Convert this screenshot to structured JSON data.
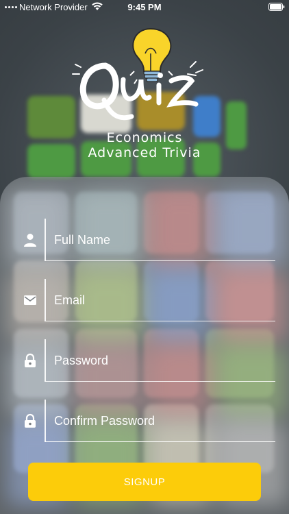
{
  "status_bar": {
    "carrier": "Network Provider",
    "time": "9:45 PM",
    "wifi_icon": "wifi-icon",
    "battery_icon": "battery-icon"
  },
  "logo": {
    "wordmark": "Quiz",
    "icon": "lightbulb-icon",
    "accent_color": "#f9d42a"
  },
  "subtitle": {
    "line1": "Economics",
    "line2": "Advanced Trivia"
  },
  "form": {
    "fields": [
      {
        "placeholder": "Full Name",
        "value": "",
        "icon": "person-icon",
        "type": "text"
      },
      {
        "placeholder": "Email",
        "value": "",
        "icon": "mail-icon",
        "type": "email"
      },
      {
        "placeholder": "Password",
        "value": "",
        "icon": "lock-icon",
        "type": "password"
      },
      {
        "placeholder": "Confirm Password",
        "value": "",
        "icon": "lock-icon",
        "type": "password"
      }
    ],
    "submit_label": "SIGNUP",
    "submit_color": "#fccc0a"
  }
}
